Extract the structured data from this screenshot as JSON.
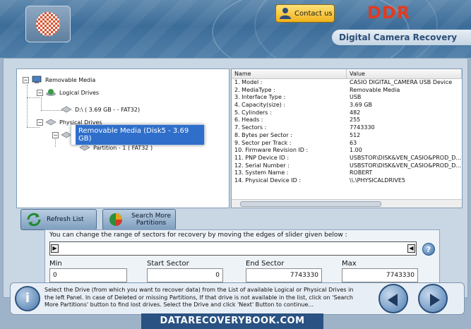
{
  "header": {
    "contact_label": "Contact us",
    "brand": "DDR",
    "subtitle": "Digital Camera Recovery"
  },
  "tree": {
    "items": [
      {
        "label": "Removable Media",
        "icon": "computer-icon"
      },
      {
        "label": "Logical Drives",
        "icon": "globe-drive-icon"
      },
      {
        "label": "D:\\ ( 3.69 GB - - FAT32)",
        "icon": "drive-icon"
      },
      {
        "label": "Physical Drives",
        "icon": "drive-icon"
      },
      {
        "label": "Partition - 1 ( FAT32 )",
        "icon": "drive-icon"
      }
    ],
    "selected": "Removable Media (Disk5 - 3.69 GB)"
  },
  "properties": {
    "headers": [
      "Name",
      "Value"
    ],
    "rows": [
      [
        "1. Model :",
        "CASIO DIGITAL_CAMERA USB Device"
      ],
      [
        "2. MediaType :",
        "Removable Media"
      ],
      [
        "3. Interface Type :",
        "USB"
      ],
      [
        "4. Capacity(size) :",
        "3.69 GB"
      ],
      [
        "5. Cylinders :",
        "482"
      ],
      [
        "6. Heads :",
        "255"
      ],
      [
        "7. Sectors :",
        "7743330"
      ],
      [
        "8. Bytes per Sector :",
        "512"
      ],
      [
        "9. Sector per Track :",
        "63"
      ],
      [
        "10. Firmware Revision ID :",
        "1.00"
      ],
      [
        "11. PNP Device ID :",
        "USBSTOR\\DISK&VEN_CASIO&PROD_D..."
      ],
      [
        "12. Serial Number :",
        "USBSTOR\\DISK&VEN_CASIO&PROD_D..."
      ],
      [
        "13. System Name :",
        "ROBERT"
      ],
      [
        "14. Physical Device ID :",
        "\\\\.\\PHYSICALDRIVE5"
      ]
    ]
  },
  "buttons": {
    "refresh": "Refresh List",
    "search_more": "Search More Partitions"
  },
  "slider": {
    "caption": "You can change the range of sectors for recovery by moving the edges of slider given below :",
    "min_label": "Min",
    "min_value": "0",
    "start_label": "Start Sector",
    "start_value": "0",
    "end_label": "End Sector",
    "end_value": "7743330",
    "max_label": "Max",
    "max_value": "7743330"
  },
  "info": {
    "text": "Select the Drive (from which you want to recover data) from the List of available Logical or Physical Drives in the left Panel. In case of Deleted or missing Partitions, If that drive is not available in the list, click on 'Search More Partitions' button to find lost drives. Select the Drive and click 'Next' Button to continue..."
  },
  "footer": "DATARECOVERYBOOK.COM",
  "colors": {
    "brand": "#e33b1f",
    "header": "#3c6d99",
    "selection": "#2f6fcb"
  }
}
